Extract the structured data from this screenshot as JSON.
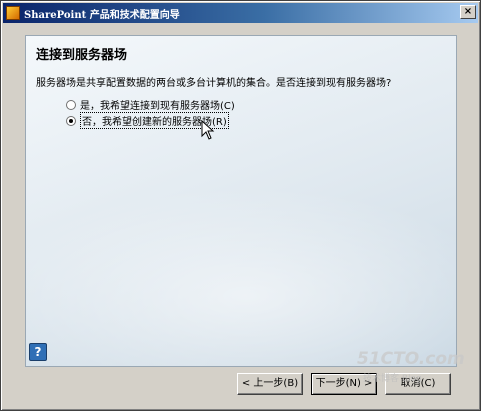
{
  "window": {
    "title": "SharePoint 产品和技术配置向导",
    "close_glyph": "×"
  },
  "page": {
    "title": "连接到服务器场",
    "question": "服务器场是共享配置数据的两台或多台计算机的集合。是否连接到现有服务器场?"
  },
  "options": [
    {
      "label": "是，我希望连接到现有服务器场(C)",
      "checked": false
    },
    {
      "label": "否，我希望创建新的服务器场(R)",
      "checked": true
    }
  ],
  "help": {
    "glyph": "?"
  },
  "buttons": {
    "back": "< 上一步(B)",
    "next": "下一步(N) >",
    "cancel": "取消(C)"
  },
  "watermark": {
    "main": "51CTO.com",
    "sub": "技术博客 Blog"
  }
}
